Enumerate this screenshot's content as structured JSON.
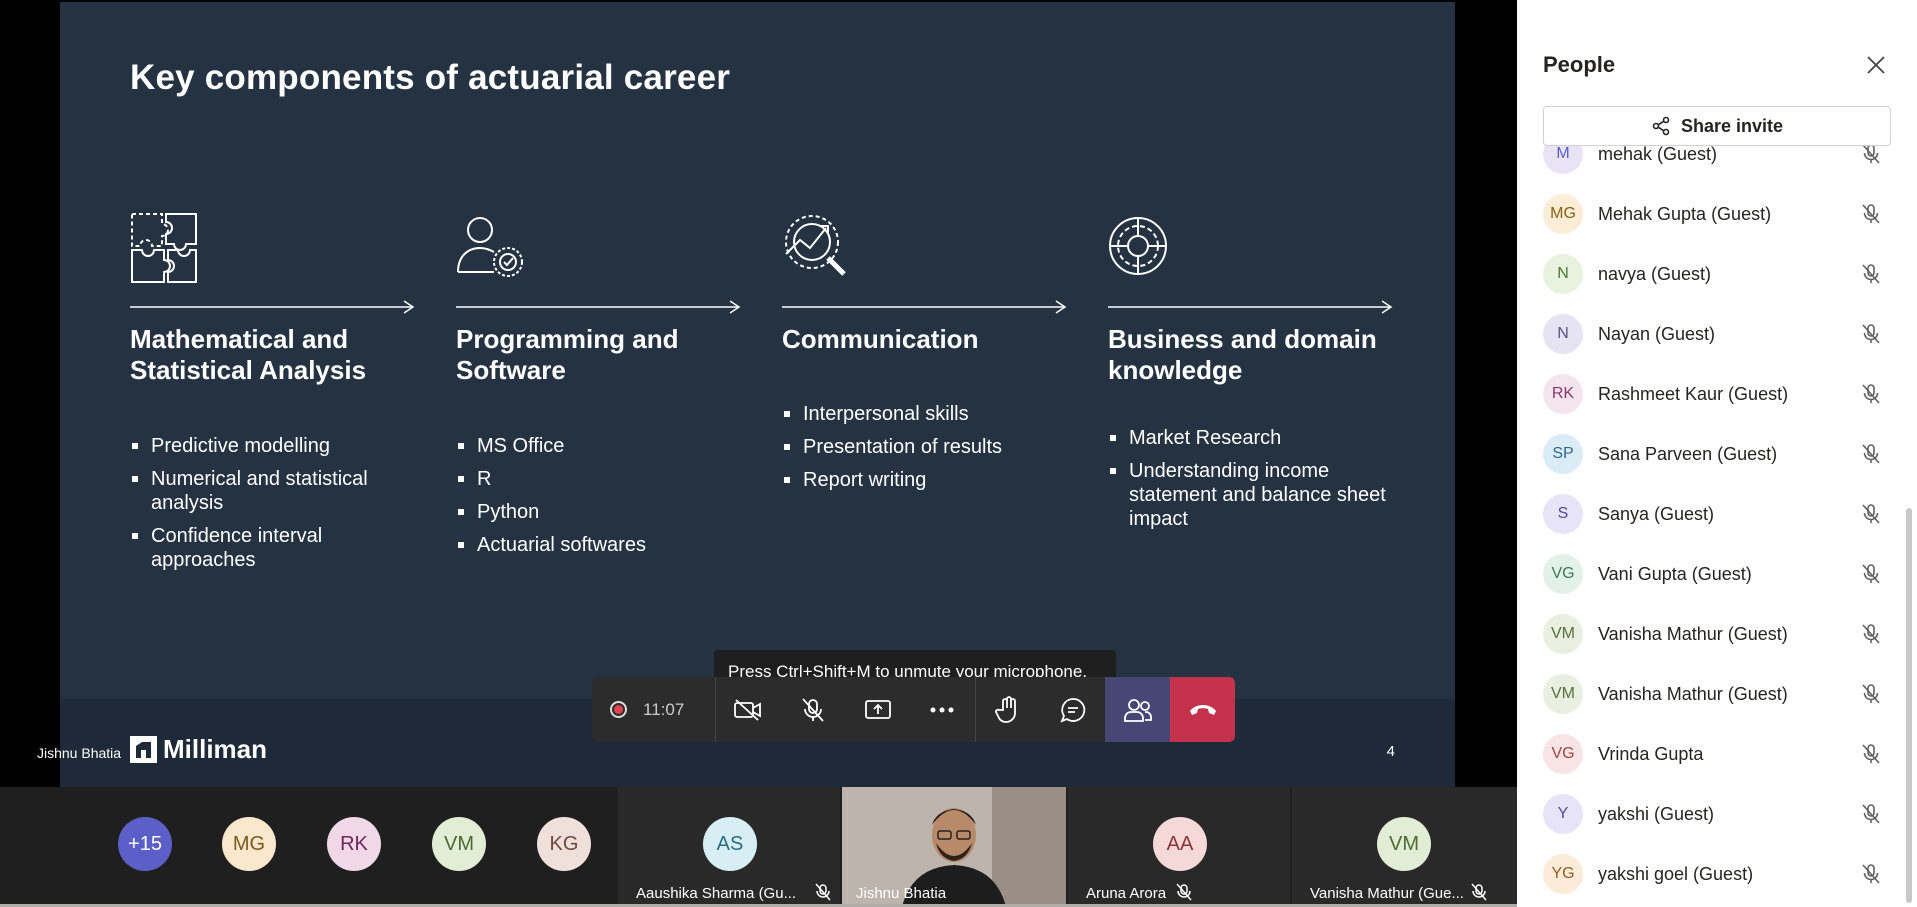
{
  "slide": {
    "title": "Key components of actuarial career",
    "columns": [
      {
        "icon": "puzzle-icon",
        "heading_line1": "Mathematical and",
        "heading_line2": "Statistical Analysis",
        "bullets": [
          "Predictive modelling",
          "Numerical and statistical analysis",
          "Confidence interval approaches"
        ]
      },
      {
        "icon": "user-gear-icon",
        "heading_line1": "Programming and",
        "heading_line2": "Software",
        "bullets": [
          "MS Office",
          "R",
          "Python",
          "Actuarial softwares"
        ]
      },
      {
        "icon": "chart-magnifier-icon",
        "heading_line1": "Communication",
        "heading_line2": "",
        "bullets": [
          "Interpersonal skills",
          "Presentation of results",
          "Report writing"
        ]
      },
      {
        "icon": "target-icon",
        "heading_line1": "Business and domain",
        "heading_line2": "knowledge",
        "bullets": [
          "Market Research",
          "Understanding income statement and balance sheet impact"
        ]
      }
    ],
    "page_number": "4",
    "logo_text": "Milliman",
    "presenter": "Jishnu Bhatia"
  },
  "tooltip": "Press Ctrl+Shift+M to unmute your microphone.",
  "controls": {
    "timer": "11:07",
    "buttons": [
      "record",
      "camera-off",
      "mic-off",
      "share",
      "more",
      "raise-hand",
      "chat",
      "people",
      "hang-up"
    ]
  },
  "people_panel": {
    "title": "People",
    "share_label": "Share invite",
    "participants": [
      {
        "initials": "M",
        "name": "mehak (Guest)",
        "bg": "#e8e4f6",
        "fg": "#5b5fc7"
      },
      {
        "initials": "MG",
        "name": "Mehak Gupta (Guest)",
        "bg": "#fbedd6",
        "fg": "#8a6114"
      },
      {
        "initials": "N",
        "name": "navya (Guest)",
        "bg": "#e7f2df",
        "fg": "#4c7a2e"
      },
      {
        "initials": "N",
        "name": "Nayan (Guest)",
        "bg": "#e6e4f2",
        "fg": "#5b4f8a"
      },
      {
        "initials": "RK",
        "name": "Rashmeet Kaur (Guest)",
        "bg": "#f4e4ee",
        "fg": "#8a3a6a"
      },
      {
        "initials": "SP",
        "name": "Sana Parveen (Guest)",
        "bg": "#dcecf6",
        "fg": "#2b6a8f"
      },
      {
        "initials": "S",
        "name": "Sanya (Guest)",
        "bg": "#e6e4f6",
        "fg": "#4f4c9a"
      },
      {
        "initials": "VG",
        "name": "Vani Gupta (Guest)",
        "bg": "#e3f2e8",
        "fg": "#3b7a52"
      },
      {
        "initials": "VM",
        "name": "Vanisha Mathur (Guest)",
        "bg": "#e9efe1",
        "fg": "#56703a"
      },
      {
        "initials": "VM",
        "name": "Vanisha Mathur (Guest)",
        "bg": "#e9efe1",
        "fg": "#56703a"
      },
      {
        "initials": "VG",
        "name": "Vrinda Gupta",
        "bg": "#f8e4e4",
        "fg": "#a04646"
      },
      {
        "initials": "Y",
        "name": "yakshi (Guest)",
        "bg": "#e6e4f6",
        "fg": "#4f4c9a"
      },
      {
        "initials": "YG",
        "name": "yakshi goel (Guest)",
        "bg": "#fbebd9",
        "fg": "#9a5c1c"
      }
    ]
  },
  "gallery": {
    "overflow": "+15",
    "avatars": [
      {
        "initials": "MG",
        "bg": "#fbe8cc",
        "fg": "#7a5a20"
      },
      {
        "initials": "RK",
        "bg": "#f0d8e8",
        "fg": "#6e2a55"
      },
      {
        "initials": "VM",
        "bg": "#e2edd6",
        "fg": "#4e6a32"
      },
      {
        "initials": "KG",
        "bg": "#efe0dc",
        "fg": "#6e4a40"
      }
    ],
    "tiles": [
      {
        "initials": "AS",
        "name": "Aaushika Sharma (Gu...",
        "bg": "#d6eef4",
        "fg": "#2a6f82"
      },
      {
        "initials": "AA",
        "name": "Aruna Arora",
        "bg": "#f5d9d9",
        "fg": "#8a3535"
      },
      {
        "initials": "VM",
        "name": "Vanisha Mathur (Gue...",
        "bg": "#e2edd6",
        "fg": "#4e6a32"
      }
    ],
    "video_name": "Jishnu Bhatia"
  }
}
